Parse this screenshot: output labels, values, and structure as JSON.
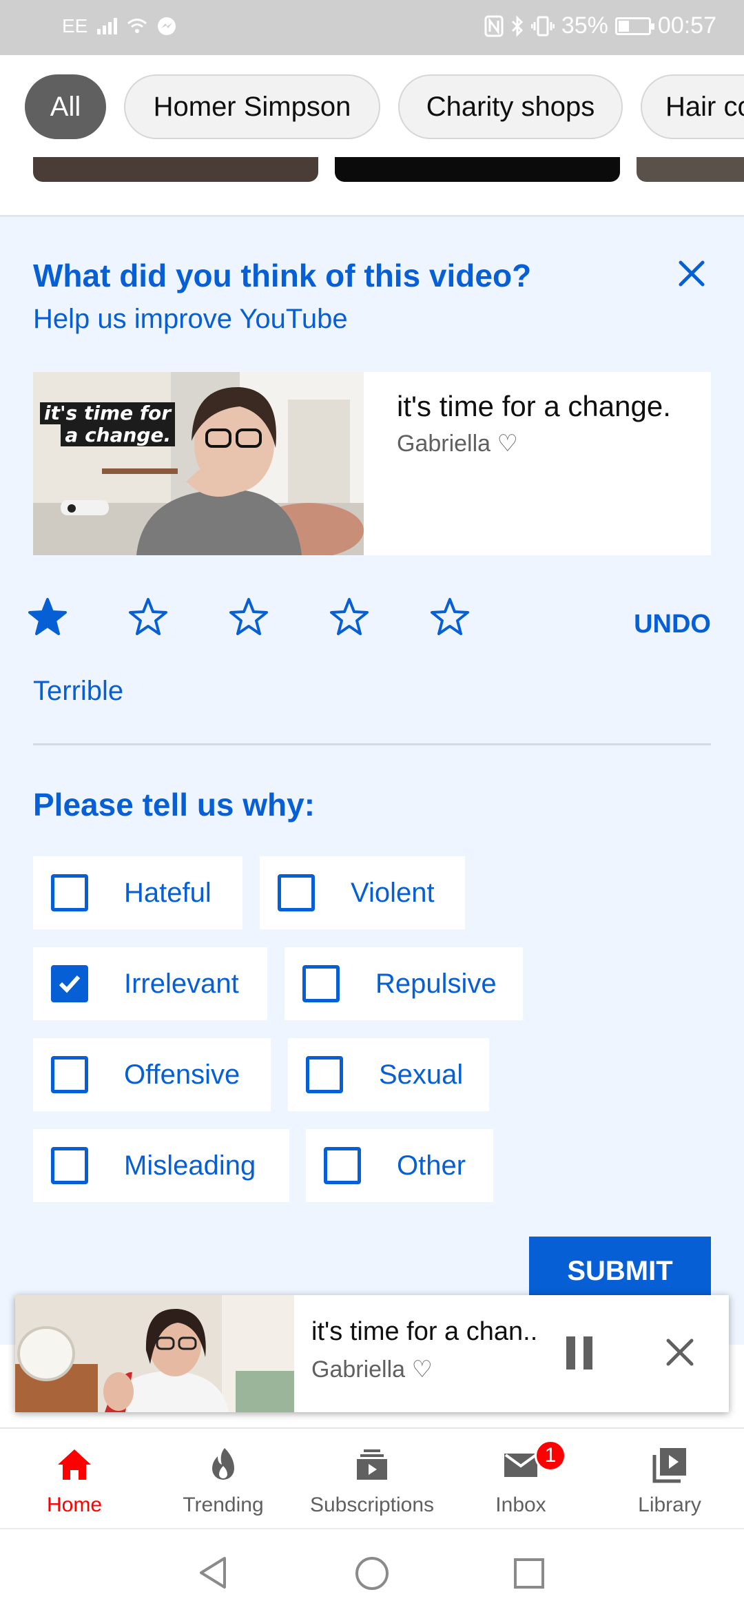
{
  "status_bar": {
    "carrier": "EE",
    "battery": "35%",
    "battery_level": 0.35,
    "time": "00:57"
  },
  "chips": [
    {
      "label": "All",
      "active": true
    },
    {
      "label": "Homer Simpson",
      "active": false
    },
    {
      "label": "Charity shops",
      "active": false
    },
    {
      "label": "Hair co",
      "active": false
    }
  ],
  "feedback": {
    "title": "What did you think of this video?",
    "subtitle": "Help us improve YouTube",
    "video": {
      "title": "it's time for a change.",
      "channel": "Gabriella ♡",
      "thumb_text_line1": "it's time for",
      "thumb_text_line2": "a change."
    },
    "rating": 1,
    "rating_max": 5,
    "rating_label": "Terrible",
    "undo_label": "UNDO",
    "why_label": "Please tell us why:",
    "options": [
      {
        "label": "Hateful",
        "checked": false
      },
      {
        "label": "Violent",
        "checked": false
      },
      {
        "label": "Irrelevant",
        "checked": true
      },
      {
        "label": "Repulsive",
        "checked": false
      },
      {
        "label": "Offensive",
        "checked": false
      },
      {
        "label": "Sexual",
        "checked": false
      },
      {
        "label": "Misleading",
        "checked": false
      },
      {
        "label": "Other",
        "checked": false
      }
    ],
    "submit_label": "SUBMIT"
  },
  "mini_player": {
    "title": "it's time for a chan..",
    "channel": "Gabriella ♡"
  },
  "bottom_nav": [
    {
      "label": "Home",
      "icon": "home-icon",
      "active": true
    },
    {
      "label": "Trending",
      "icon": "trending-icon",
      "active": false
    },
    {
      "label": "Subscriptions",
      "icon": "subscriptions-icon",
      "active": false
    },
    {
      "label": "Inbox",
      "icon": "inbox-icon",
      "active": false,
      "badge": "1"
    },
    {
      "label": "Library",
      "icon": "library-icon",
      "active": false
    }
  ],
  "colors": {
    "accent": "#065fd4",
    "brand_red": "#ff0000",
    "panel_bg": "#eef5fe"
  }
}
